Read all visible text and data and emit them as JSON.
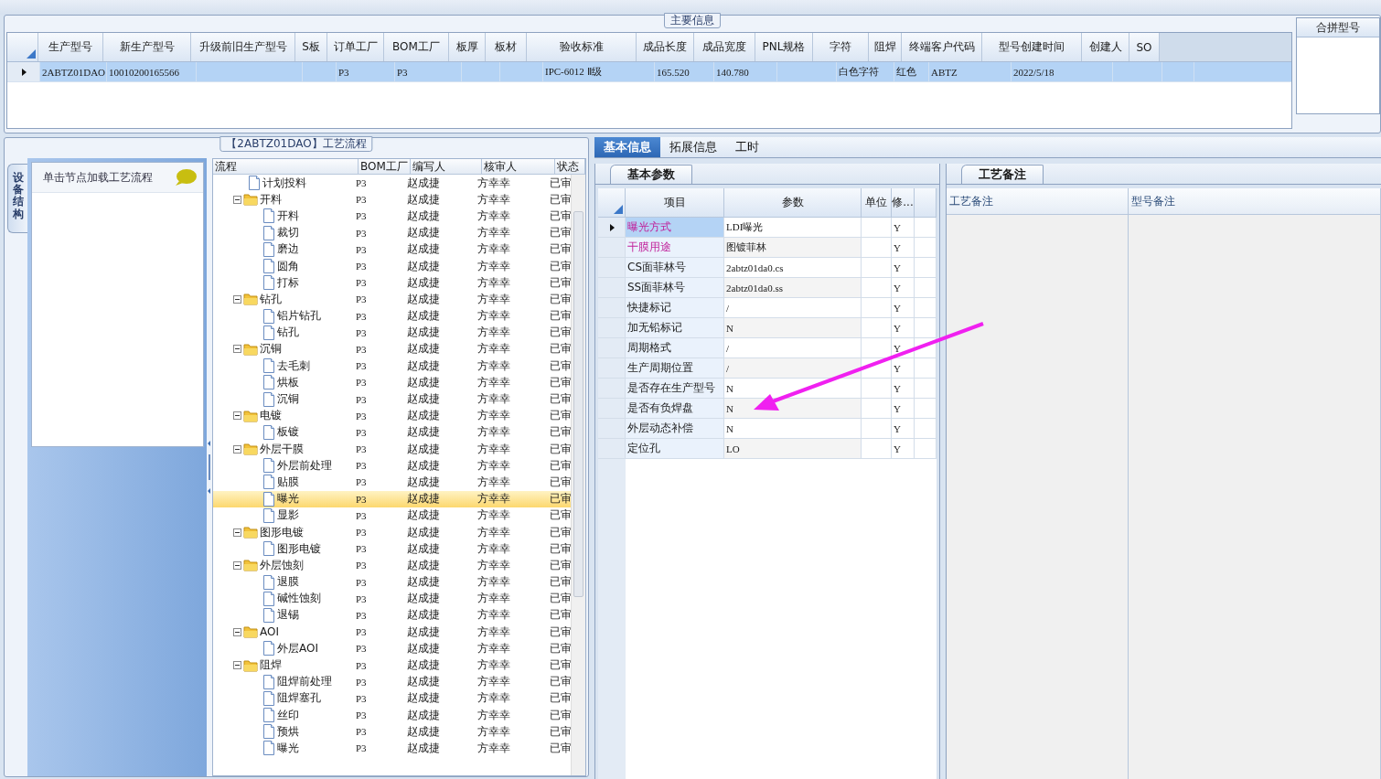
{
  "main_info": {
    "title": "主要信息",
    "columns": [
      {
        "label": "生产型号",
        "value": "2ABTZ01DAO"
      },
      {
        "label": "新生产型号",
        "value": "10010200165566"
      },
      {
        "label": "升级前旧生产型号"
      },
      {
        "label": "S板"
      },
      {
        "label": "订单工厂",
        "value": "P3"
      },
      {
        "label": "BOM工厂",
        "value": "P3"
      },
      {
        "label": "板厚"
      },
      {
        "label": "板材"
      },
      {
        "label": "验收标准",
        "value": "IPC-6012 Ⅱ级"
      },
      {
        "label": "成品长度",
        "value": "165.520"
      },
      {
        "label": "成品宽度",
        "value": "140.780"
      },
      {
        "label": "PNL规格"
      },
      {
        "label": "字符",
        "value": "白色字符"
      },
      {
        "label": "阻焊",
        "value": "红色"
      },
      {
        "label": "终端客户代码",
        "value": "ABTZ"
      },
      {
        "label": "型号创建时间",
        "value": "2022/5/18"
      },
      {
        "label": "创建人"
      },
      {
        "label": "SO"
      }
    ],
    "row_selected": true,
    "merge_panel": {
      "title": "合拼型号"
    }
  },
  "process": {
    "title": "【2ABTZ01DAO】工艺流程",
    "side_tab": "设备结构",
    "hint": "单击节点加载工艺流程",
    "columns": [
      "流程",
      "BOM工厂",
      "编写人",
      "核审人",
      "状态"
    ],
    "nodes": [
      {
        "kind": "leaf",
        "name": "计划投料",
        "bom": "P3",
        "author": "赵成捷",
        "reviewer": "方幸幸",
        "status": "已审",
        "selected": false
      },
      {
        "kind": "group",
        "name": "开料",
        "bom": "P3",
        "author": "赵成捷",
        "reviewer": "方幸幸",
        "status": "已审",
        "selected": false,
        "expanded": true,
        "children": [
          {
            "kind": "leaf",
            "name": "开料",
            "bom": "P3",
            "author": "赵成捷",
            "reviewer": "方幸幸",
            "status": "已审",
            "selected": false
          },
          {
            "kind": "leaf",
            "name": "裁切",
            "bom": "P3",
            "author": "赵成捷",
            "reviewer": "方幸幸",
            "status": "已审",
            "selected": false
          },
          {
            "kind": "leaf",
            "name": "磨边",
            "bom": "P3",
            "author": "赵成捷",
            "reviewer": "方幸幸",
            "status": "已审",
            "selected": false
          },
          {
            "kind": "leaf",
            "name": "圆角",
            "bom": "P3",
            "author": "赵成捷",
            "reviewer": "方幸幸",
            "status": "已审",
            "selected": false
          },
          {
            "kind": "leaf",
            "name": "打标",
            "bom": "P3",
            "author": "赵成捷",
            "reviewer": "方幸幸",
            "status": "已审",
            "selected": false
          }
        ]
      },
      {
        "kind": "group",
        "name": "钻孔",
        "bom": "P3",
        "author": "赵成捷",
        "reviewer": "方幸幸",
        "status": "已审",
        "selected": false,
        "expanded": true,
        "children": [
          {
            "kind": "leaf",
            "name": "铝片钻孔",
            "bom": "P3",
            "author": "赵成捷",
            "reviewer": "方幸幸",
            "status": "已审",
            "selected": false
          },
          {
            "kind": "leaf",
            "name": "钻孔",
            "bom": "P3",
            "author": "赵成捷",
            "reviewer": "方幸幸",
            "status": "已审",
            "selected": false
          }
        ]
      },
      {
        "kind": "group",
        "name": "沉铜",
        "bom": "P3",
        "author": "赵成捷",
        "reviewer": "方幸幸",
        "status": "已审",
        "selected": false,
        "expanded": true,
        "children": [
          {
            "kind": "leaf",
            "name": "去毛刺",
            "bom": "P3",
            "author": "赵成捷",
            "reviewer": "方幸幸",
            "status": "已审",
            "selected": false
          },
          {
            "kind": "leaf",
            "name": "烘板",
            "bom": "P3",
            "author": "赵成捷",
            "reviewer": "方幸幸",
            "status": "已审",
            "selected": false
          },
          {
            "kind": "leaf",
            "name": "沉铜",
            "bom": "P3",
            "author": "赵成捷",
            "reviewer": "方幸幸",
            "status": "已审",
            "selected": false
          }
        ]
      },
      {
        "kind": "group",
        "name": "电镀",
        "bom": "P3",
        "author": "赵成捷",
        "reviewer": "方幸幸",
        "status": "已审",
        "selected": false,
        "expanded": true,
        "children": [
          {
            "kind": "leaf",
            "name": "板镀",
            "bom": "P3",
            "author": "赵成捷",
            "reviewer": "方幸幸",
            "status": "已审",
            "selected": false
          }
        ]
      },
      {
        "kind": "group",
        "name": "外层干膜",
        "bom": "P3",
        "author": "赵成捷",
        "reviewer": "方幸幸",
        "status": "已审",
        "selected": false,
        "expanded": true,
        "children": [
          {
            "kind": "leaf",
            "name": "外层前处理",
            "bom": "P3",
            "author": "赵成捷",
            "reviewer": "方幸幸",
            "status": "已审",
            "selected": false
          },
          {
            "kind": "leaf",
            "name": "贴膜",
            "bom": "P3",
            "author": "赵成捷",
            "reviewer": "方幸幸",
            "status": "已审",
            "selected": false
          },
          {
            "kind": "leaf",
            "name": "曝光",
            "bom": "P3",
            "author": "赵成捷",
            "reviewer": "方幸幸",
            "status": "已审",
            "selected": true
          },
          {
            "kind": "leaf",
            "name": "显影",
            "bom": "P3",
            "author": "赵成捷",
            "reviewer": "方幸幸",
            "status": "已审",
            "selected": false
          }
        ]
      },
      {
        "kind": "group",
        "name": "图形电镀",
        "bom": "P3",
        "author": "赵成捷",
        "reviewer": "方幸幸",
        "status": "已审",
        "selected": false,
        "expanded": true,
        "children": [
          {
            "kind": "leaf",
            "name": "图形电镀",
            "bom": "P3",
            "author": "赵成捷",
            "reviewer": "方幸幸",
            "status": "已审",
            "selected": false
          }
        ]
      },
      {
        "kind": "group",
        "name": "外层蚀刻",
        "bom": "P3",
        "author": "赵成捷",
        "reviewer": "方幸幸",
        "status": "已审",
        "selected": false,
        "expanded": true,
        "children": [
          {
            "kind": "leaf",
            "name": "退膜",
            "bom": "P3",
            "author": "赵成捷",
            "reviewer": "方幸幸",
            "status": "已审",
            "selected": false
          },
          {
            "kind": "leaf",
            "name": "碱性蚀刻",
            "bom": "P3",
            "author": "赵成捷",
            "reviewer": "方幸幸",
            "status": "已审",
            "selected": false
          },
          {
            "kind": "leaf",
            "name": "退锡",
            "bom": "P3",
            "author": "赵成捷",
            "reviewer": "方幸幸",
            "status": "已审",
            "selected": false
          }
        ]
      },
      {
        "kind": "group",
        "name": "AOI",
        "bom": "P3",
        "author": "赵成捷",
        "reviewer": "方幸幸",
        "status": "已审",
        "selected": false,
        "expanded": true,
        "children": [
          {
            "kind": "leaf",
            "name": "外层AOI",
            "bom": "P3",
            "author": "赵成捷",
            "reviewer": "方幸幸",
            "status": "已审",
            "selected": false
          }
        ]
      },
      {
        "kind": "group",
        "name": "阻焊",
        "bom": "P3",
        "author": "赵成捷",
        "reviewer": "方幸幸",
        "status": "已审",
        "selected": false,
        "expanded": true,
        "children": [
          {
            "kind": "leaf",
            "name": "阻焊前处理",
            "bom": "P3",
            "author": "赵成捷",
            "reviewer": "方幸幸",
            "status": "已审",
            "selected": false
          },
          {
            "kind": "leaf",
            "name": "阻焊塞孔",
            "bom": "P3",
            "author": "赵成捷",
            "reviewer": "方幸幸",
            "status": "已审",
            "selected": false
          },
          {
            "kind": "leaf",
            "name": "丝印",
            "bom": "P3",
            "author": "赵成捷",
            "reviewer": "方幸幸",
            "status": "已审",
            "selected": false
          },
          {
            "kind": "leaf",
            "name": "预烘",
            "bom": "P3",
            "author": "赵成捷",
            "reviewer": "方幸幸",
            "status": "已审",
            "selected": false
          },
          {
            "kind": "leaf",
            "name": "曝光",
            "bom": "P3",
            "author": "赵成捷",
            "reviewer": "方幸幸",
            "status": "已审",
            "selected": false
          }
        ]
      }
    ]
  },
  "tabs": [
    {
      "label": "基本信息",
      "selected": true
    },
    {
      "label": "拓展信息",
      "selected": false
    },
    {
      "label": "工时",
      "selected": false
    }
  ],
  "params": {
    "title": "基本参数",
    "columns": [
      "项目",
      "参数",
      "单位",
      "修..."
    ],
    "rows": [
      {
        "item": "曝光方式",
        "value": "LDI曝光",
        "flag": "Y",
        "highlighted": true,
        "selected": true
      },
      {
        "item": "干膜用途",
        "value": "图镀菲林",
        "flag": "Y",
        "highlighted": true,
        "selected": false
      },
      {
        "item": "CS面菲林号",
        "value": "2abtz01da0.cs",
        "flag": "Y",
        "highlighted": false,
        "selected": false
      },
      {
        "item": "SS面菲林号",
        "value": "2abtz01da0.ss",
        "flag": "Y",
        "highlighted": false,
        "selected": false
      },
      {
        "item": "快捷标记",
        "value": "/",
        "flag": "Y",
        "highlighted": false,
        "selected": false
      },
      {
        "item": "加无铅标记",
        "value": "N",
        "flag": "Y",
        "highlighted": false,
        "selected": false
      },
      {
        "item": "周期格式",
        "value": "/",
        "flag": "Y",
        "highlighted": false,
        "selected": false
      },
      {
        "item": "生产周期位置",
        "value": "/",
        "flag": "Y",
        "highlighted": false,
        "selected": false
      },
      {
        "item": "是否存在生产型号",
        "value": "N",
        "flag": "Y",
        "highlighted": false,
        "selected": false
      },
      {
        "item": "是否有负焊盘",
        "value": "N",
        "flag": "Y",
        "highlighted": false,
        "selected": false
      },
      {
        "item": "外层动态补偿",
        "value": "N",
        "flag": "Y",
        "highlighted": false,
        "selected": false
      },
      {
        "item": "定位孔",
        "value": "LO",
        "flag": "Y",
        "highlighted": false,
        "selected": false
      }
    ]
  },
  "notes": {
    "title": "工艺备注",
    "columns": [
      "工艺备注",
      "型号备注"
    ]
  }
}
